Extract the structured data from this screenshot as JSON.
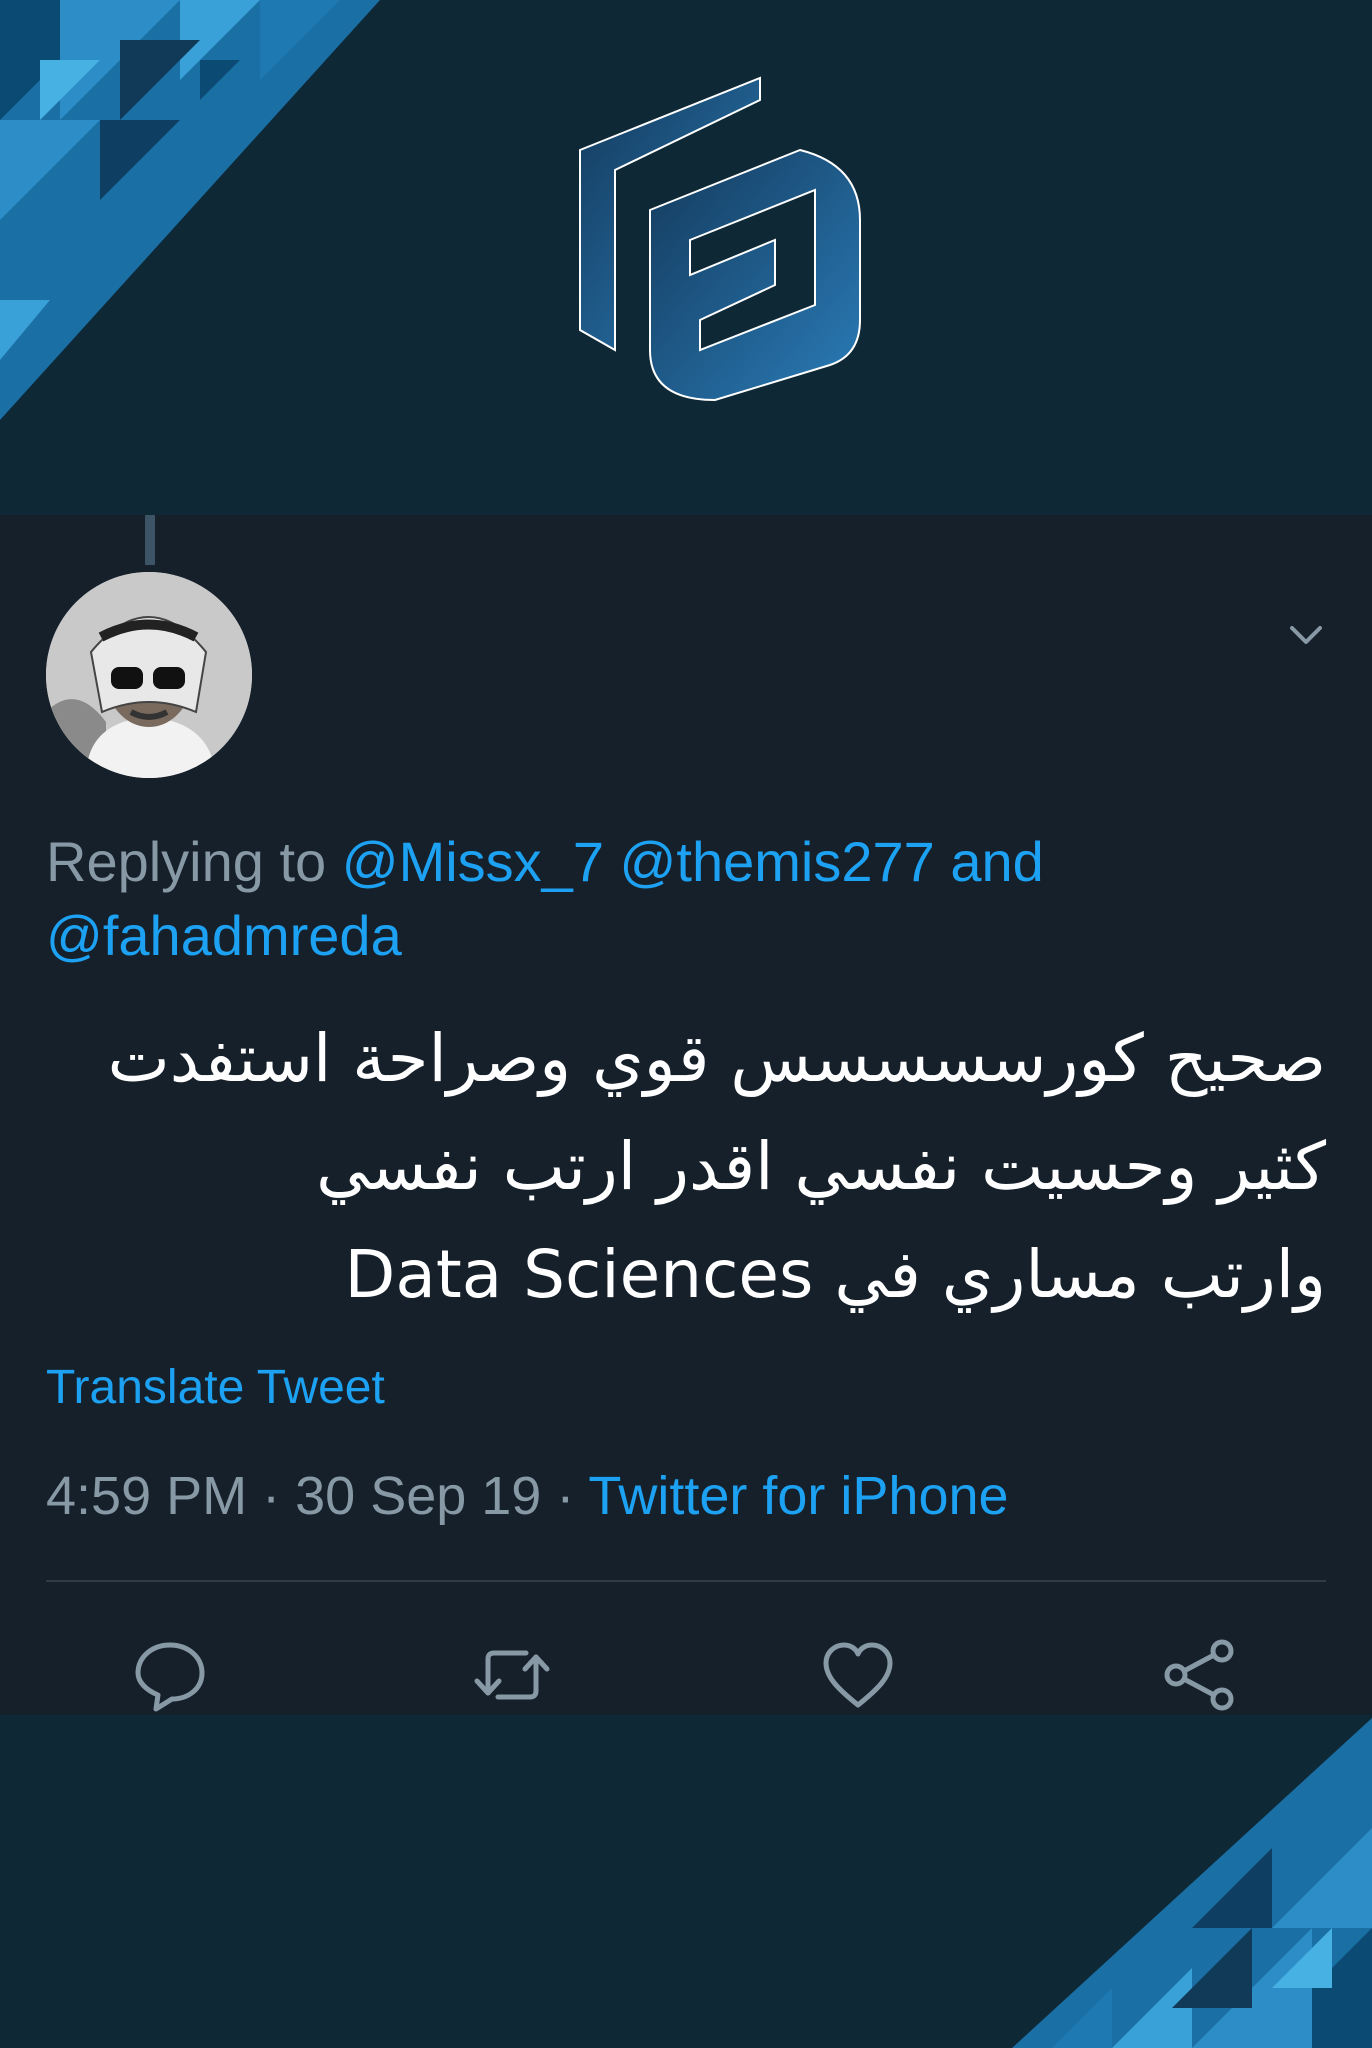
{
  "tweet": {
    "reply_prefix": "Replying to",
    "mentions": [
      "@Missx_7",
      "@themis277"
    ],
    "and_word": "and",
    "mention_last": "@fahadmreda",
    "text_line1": "صحيح كورسسسسس قوي وصراحة استفدت",
    "text_line2": "كثير وحسيت نفسي اقدر ارتب نفسي",
    "text_line3": "وارتب مساري في Data Sciences",
    "translate_label": "Translate Tweet",
    "time": "4:59 PM",
    "separator": "·",
    "date": "30 Sep 19",
    "source": "Twitter for iPhone"
  },
  "icons": {
    "more": "chevron-down-icon",
    "reply": "reply-icon",
    "retweet": "retweet-icon",
    "like": "heart-icon",
    "share": "share-icon"
  },
  "colors": {
    "background": "#0e2836",
    "card": "#16202b",
    "accent": "#1da1f2",
    "muted": "#8899a6",
    "logo": "#1f5d8f"
  }
}
